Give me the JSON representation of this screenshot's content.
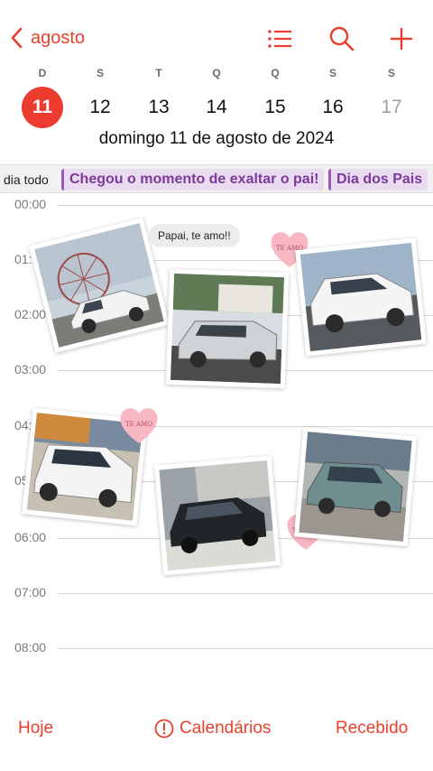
{
  "header": {
    "back_label": "agosto",
    "icons": [
      "list-icon",
      "search-icon",
      "plus-icon"
    ],
    "accent_color": "#e8402f"
  },
  "week": {
    "weekdays": [
      "D",
      "S",
      "T",
      "Q",
      "Q",
      "S",
      "S"
    ],
    "days": [
      "11",
      "12",
      "13",
      "14",
      "15",
      "16",
      "17"
    ],
    "selected_day": "11"
  },
  "full_date": "domingo  11 de agosto de 2024",
  "all_day": {
    "label": "dia todo",
    "events": [
      "Chegou o momento de exaltar o pai!",
      "Dia dos Pais"
    ],
    "event_color": "#9b59b6"
  },
  "hours": [
    "00:00",
    "01:",
    "02:00",
    "03:00",
    "04:",
    "05",
    "06:00",
    "07:00",
    "08:00"
  ],
  "stickers": {
    "bubble_text": "Papai, te amo!!",
    "heart_text": "TE AMO"
  },
  "bottom": {
    "today": "Hoje",
    "calendars": "Calendários",
    "inbox": "Recebido"
  }
}
